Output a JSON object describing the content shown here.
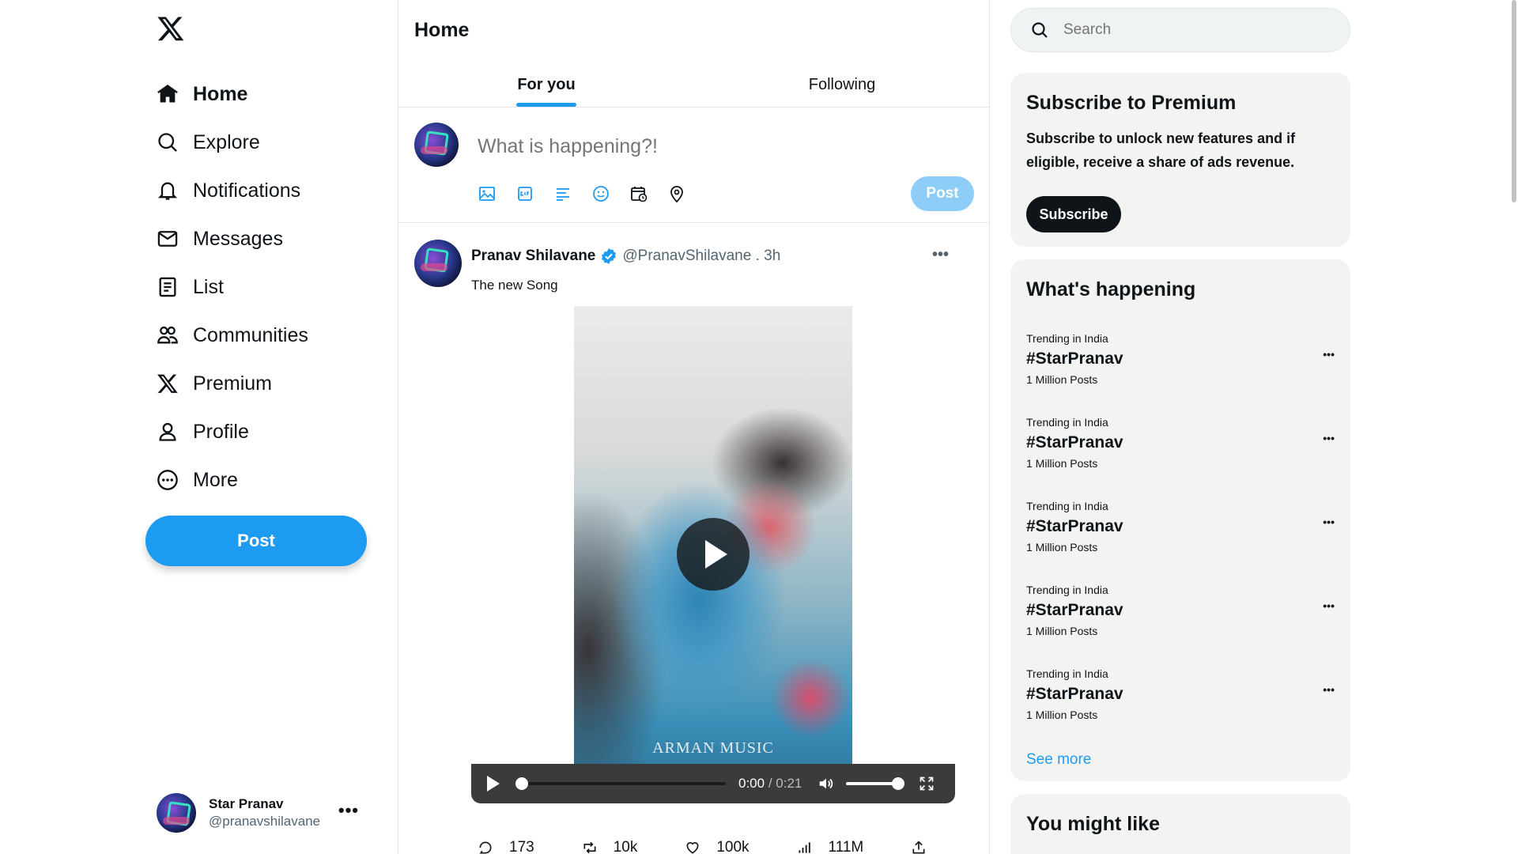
{
  "sidebar": {
    "items": [
      {
        "label": "Home",
        "icon": "home-icon"
      },
      {
        "label": "Explore",
        "icon": "search-icon"
      },
      {
        "label": "Notifications",
        "icon": "bell-icon"
      },
      {
        "label": "Messages",
        "icon": "mail-icon"
      },
      {
        "label": "List",
        "icon": "list-icon"
      },
      {
        "label": "Communities",
        "icon": "communities-icon"
      },
      {
        "label": "Premium",
        "icon": "x-logo-icon"
      },
      {
        "label": "Profile",
        "icon": "person-icon"
      },
      {
        "label": "More",
        "icon": "more-circle-icon"
      }
    ],
    "post_label": "Post",
    "account": {
      "name": "Star Pranav",
      "handle": "@pranavshilavane",
      "more": "•••"
    }
  },
  "main": {
    "title": "Home",
    "tabs": [
      {
        "label": "For you",
        "active": true
      },
      {
        "label": "Following",
        "active": false
      }
    ],
    "composer": {
      "placeholder": "What is happening?!",
      "post_label": "Post",
      "tools": [
        "image-icon",
        "gif-icon",
        "poll-icon",
        "emoji-icon",
        "schedule-icon",
        "location-icon"
      ]
    },
    "tweet": {
      "author": "Pranav Shilavane",
      "handle": "@PranavShilavane . 3h",
      "more": "•••",
      "text": "The new Song",
      "watermark": "ARMAN MUSIC",
      "video": {
        "current": "0:00",
        "separator": " / ",
        "duration": "0:21"
      },
      "stats": {
        "replies": "173",
        "reposts": "10k",
        "likes": "100k",
        "views": "111M"
      }
    }
  },
  "right": {
    "search_placeholder": "Search",
    "premium": {
      "title": "Subscribe to Premium",
      "desc": "Subscribe to unlock new features and if eligible, receive a share of ads revenue.",
      "button": "Subscribe"
    },
    "happening": {
      "title": "What's happening",
      "trends": [
        {
          "context": "Trending in India",
          "tag": "#StarPranav",
          "count": "1 Million Posts"
        },
        {
          "context": "Trending in India",
          "tag": "#StarPranav",
          "count": "1 Million Posts"
        },
        {
          "context": "Trending in India",
          "tag": "#StarPranav",
          "count": "1 Million Posts"
        },
        {
          "context": "Trending in India",
          "tag": "#StarPranav",
          "count": "1 Million Posts"
        },
        {
          "context": "Trending in India",
          "tag": "#StarPranav",
          "count": "1 Million Posts"
        }
      ],
      "trend_more": "•••",
      "see_more": "See more"
    },
    "might_like": {
      "title": "You might like"
    }
  },
  "colors": {
    "accent": "#1d9bf0",
    "accent_disabled": "#8ecdf8",
    "text": "#0f1419",
    "muted": "#536471"
  }
}
